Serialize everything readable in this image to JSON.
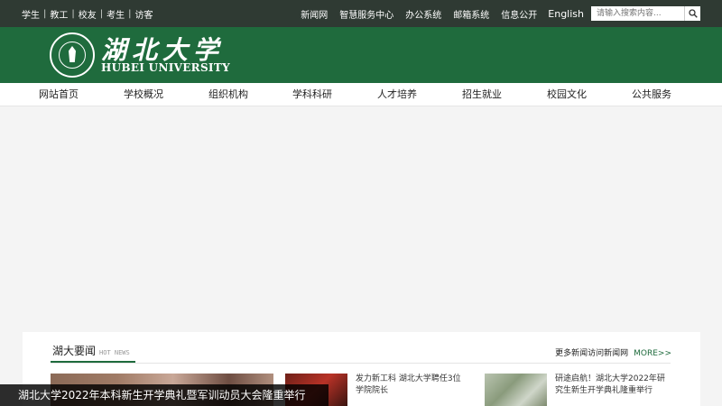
{
  "topbar": {
    "left_links": [
      "学生",
      "教工",
      "校友",
      "考生",
      "访客"
    ],
    "separator": "|",
    "right_links": [
      "新闻网",
      "智慧服务中心",
      "办公系统",
      "邮箱系统",
      "信息公开"
    ],
    "language": "English",
    "search_placeholder": "请输入搜索内容..."
  },
  "brand": {
    "name_cn": "湖北大学",
    "name_en": "HUBEI UNIVERSITY",
    "seal_icon": "university-seal-icon"
  },
  "nav": {
    "items": [
      "网站首页",
      "学校概况",
      "组织机构",
      "学科科研",
      "人才培养",
      "招生就业",
      "校园文化",
      "公共服务"
    ]
  },
  "news": {
    "title": "湖大要闻",
    "title_en": "HOT NEWS",
    "more_text": "更多新闻访问新闻网",
    "more_link": "MORE>>",
    "feature_caption": "湖北大学2022年本科新生开学典礼暨军训动员大会隆重举行",
    "items": [
      {
        "title": "发力新工科 湖北大学聘任3位学院院长"
      },
      {
        "title": "研途启航！湖北大学2022年研究生新生开学典礼隆重举行"
      }
    ]
  },
  "colors": {
    "topbar_bg": "#2f3a33",
    "brand_green": "#1f6b3d",
    "page_bg": "#f4f4f4"
  }
}
